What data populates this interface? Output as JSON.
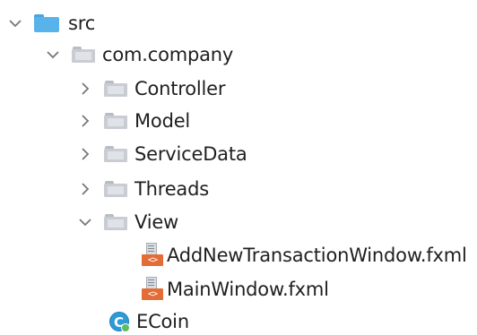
{
  "project_tree": {
    "items": [
      {
        "label": "src",
        "icon": "source-folder-icon",
        "state": "expanded"
      },
      {
        "label": "com.company",
        "icon": "package-folder-icon",
        "state": "expanded"
      },
      {
        "label": "Controller",
        "icon": "package-folder-icon",
        "state": "collapsed"
      },
      {
        "label": "Model",
        "icon": "package-folder-icon",
        "state": "collapsed"
      },
      {
        "label": "ServiceData",
        "icon": "package-folder-icon",
        "state": "collapsed"
      },
      {
        "label": "Threads",
        "icon": "package-folder-icon",
        "state": "collapsed"
      },
      {
        "label": "View",
        "icon": "package-folder-icon",
        "state": "expanded"
      },
      {
        "label": "AddNewTransactionWindow.fxml",
        "icon": "fxml-file-icon",
        "state": "leaf"
      },
      {
        "label": "MainWindow.fxml",
        "icon": "fxml-file-icon",
        "state": "leaf"
      },
      {
        "label": "ECoin",
        "icon": "java-class-icon",
        "state": "leaf"
      }
    ]
  },
  "colors": {
    "source_folder": "#57b3ea",
    "package_folder": "#c9ccd2",
    "fxml_badge": "#e46d37",
    "java_class": "#2f9bd6",
    "text": "#1f1f1f"
  }
}
